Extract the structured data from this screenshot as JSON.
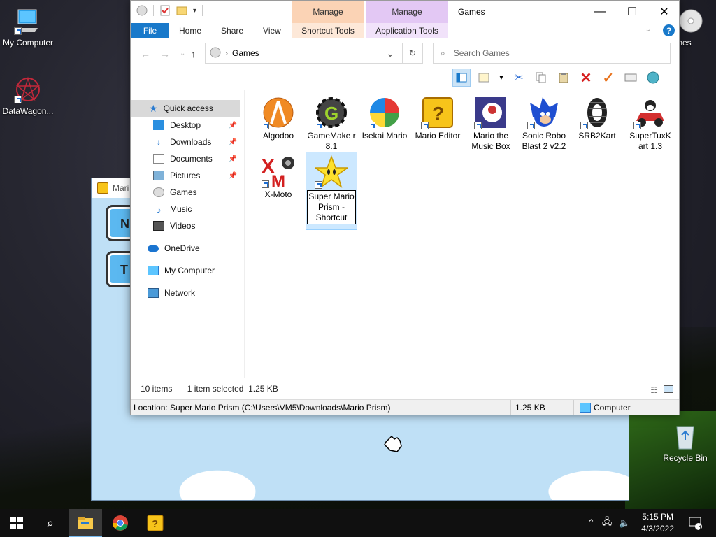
{
  "desktop": {
    "icons": [
      {
        "label": "My Computer"
      },
      {
        "label": "DataWagon..."
      },
      {
        "label": "mes"
      },
      {
        "label": "Recycle Bin"
      }
    ]
  },
  "game_window": {
    "title": "Mari",
    "buttons": [
      {
        "label": "N"
      },
      {
        "label": "T"
      }
    ]
  },
  "explorer": {
    "title": "Games",
    "context_tabs": [
      {
        "group": "Manage",
        "tab": "Shortcut Tools",
        "color": "#fbd3b5"
      },
      {
        "group": "Manage",
        "tab": "Application Tools",
        "color": "#e3c8f4"
      }
    ],
    "ribbon_tabs": [
      "File",
      "Home",
      "Share",
      "View"
    ],
    "address": {
      "path": "Games"
    },
    "search": {
      "placeholder": "Search Games"
    },
    "nav_pane": [
      {
        "label": "Quick access",
        "icon": "star-icon",
        "selected": true
      },
      {
        "label": "Desktop",
        "icon": "desktop-icon",
        "pinned": true
      },
      {
        "label": "Downloads",
        "icon": "download-arrow-icon",
        "pinned": true
      },
      {
        "label": "Documents",
        "icon": "document-icon",
        "pinned": true
      },
      {
        "label": "Pictures",
        "icon": "pictures-icon",
        "pinned": true
      },
      {
        "label": "Games",
        "icon": "disc-icon"
      },
      {
        "label": "Music",
        "icon": "music-note-icon"
      },
      {
        "label": "Videos",
        "icon": "film-icon"
      },
      {
        "label": "OneDrive",
        "icon": "cloud-icon"
      },
      {
        "label": "My Computer",
        "icon": "computer-icon"
      },
      {
        "label": "Network",
        "icon": "network-icon"
      }
    ],
    "files": [
      {
        "label": "Algodoo",
        "icon": "algodoo-icon"
      },
      {
        "label": "GameMake r 8.1",
        "icon": "gamemaker-icon"
      },
      {
        "label": "Isekai Mario",
        "icon": "isekai-mario-icon"
      },
      {
        "label": "Mario Editor",
        "icon": "question-block-icon"
      },
      {
        "label": "Mario the Music Box",
        "icon": "music-box-icon"
      },
      {
        "label": "Sonic Robo Blast 2 v2.2",
        "icon": "sonic-icon"
      },
      {
        "label": "SRB2Kart",
        "icon": "tire-icon"
      },
      {
        "label": "SuperTuxK art 1.3",
        "icon": "kart-icon"
      },
      {
        "label": "X-Moto",
        "icon": "xmoto-icon"
      },
      {
        "label": "Super Mario Prism - Shortcut",
        "icon": "star-shortcut-icon",
        "selected": true,
        "renaming": true
      }
    ],
    "status": {
      "items": "10 items",
      "selected": "1 item selected  1.25 KB"
    },
    "location_bar": {
      "location": "Location: Super Mario Prism (C:\\Users\\VM5\\Downloads\\Mario Prism)",
      "size": "1.25 KB",
      "zone": "Computer"
    }
  },
  "taskbar": {
    "clock_time": "5:15 PM",
    "clock_date": "4/3/2022",
    "notifications": "1"
  }
}
